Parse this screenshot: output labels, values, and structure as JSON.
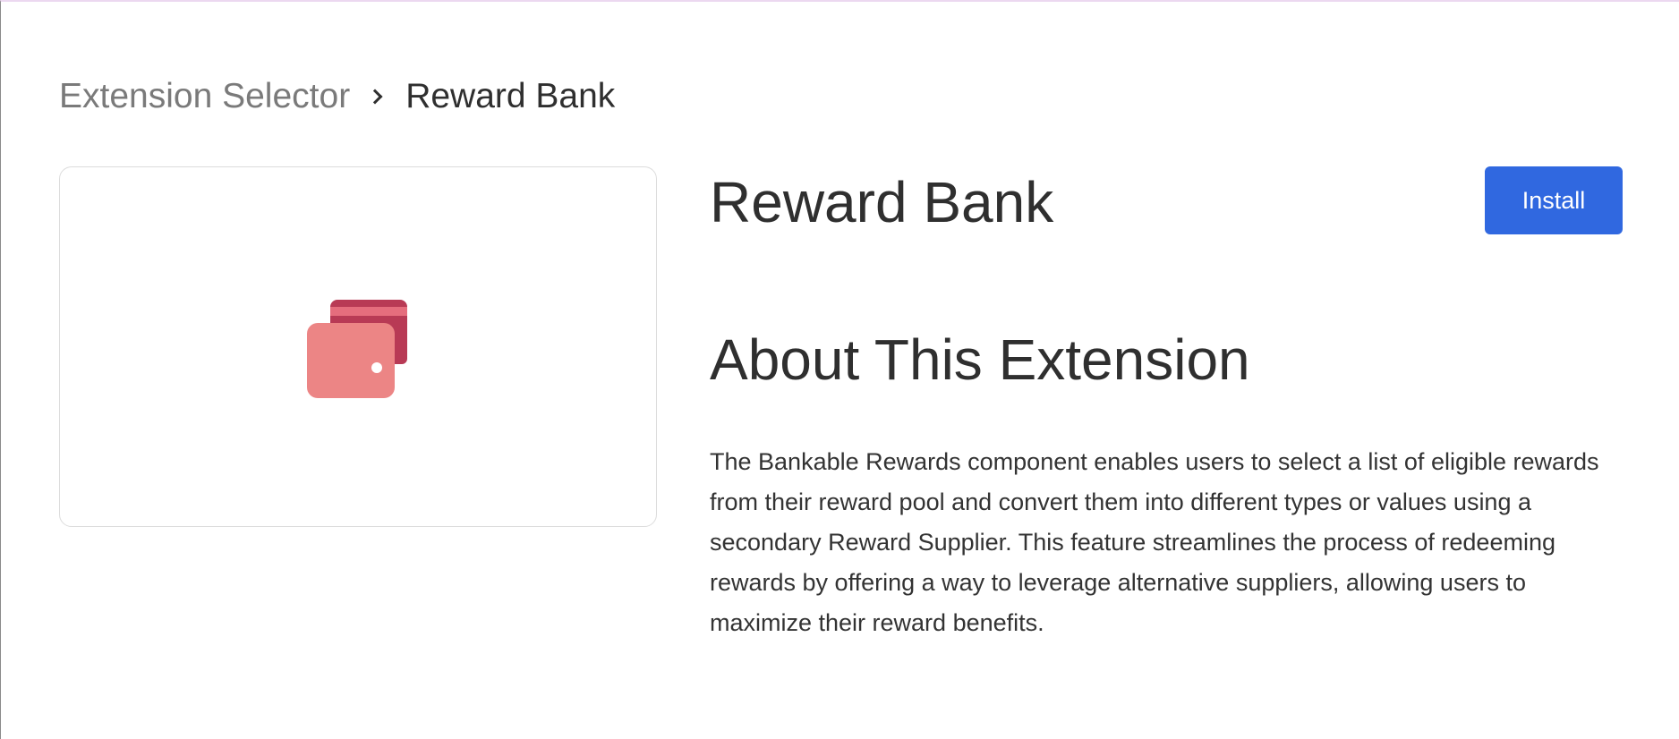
{
  "breadcrumb": {
    "parent": "Extension Selector",
    "current": "Reward Bank"
  },
  "extension": {
    "title": "Reward Bank",
    "install_label": "Install",
    "about_heading": "About This Extension",
    "description": "The Bankable Rewards component enables users to select a list of eligible rewards from their reward pool and convert them into different types or values using a secondary Reward Supplier. This feature streamlines the process of redeeming rewards by offering a way to leverage alternative suppliers, allowing users to maximize their reward benefits.",
    "icon": "wallet-with-bills-icon"
  },
  "colors": {
    "accent": "#3068e0",
    "wallet_front": "#ec8585",
    "wallet_back": "#b83a55",
    "wallet_mid": "#f3a0a0"
  }
}
